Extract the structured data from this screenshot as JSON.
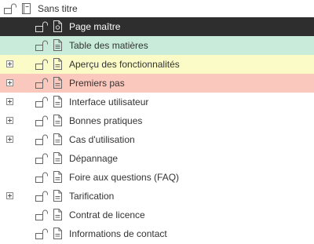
{
  "colors": {
    "selected_bg": "#2e2e2e",
    "green_bg": "#c8ecd9",
    "yellow_bg": "#fbfbc8",
    "red_bg": "#fbc8bd"
  },
  "root": {
    "label": "Sans titre",
    "icon": "notebook-icon"
  },
  "items": [
    {
      "label": "Page maître",
      "icon": "master-page-icon",
      "expandable": false,
      "state": "selected"
    },
    {
      "label": "Table des matières",
      "icon": "toc-page-icon",
      "expandable": false,
      "state": "green"
    },
    {
      "label": "Aperçu des fonctionnalités",
      "icon": "page-icon",
      "expandable": true,
      "state": "yellow"
    },
    {
      "label": "Premiers pas",
      "icon": "page-icon",
      "expandable": true,
      "state": "red"
    },
    {
      "label": "Interface utilisateur",
      "icon": "page-icon",
      "expandable": true,
      "state": "normal"
    },
    {
      "label": "Bonnes pratiques",
      "icon": "page-icon",
      "expandable": true,
      "state": "normal"
    },
    {
      "label": "Cas d'utilisation",
      "icon": "page-icon",
      "expandable": true,
      "state": "normal"
    },
    {
      "label": "Dépannage",
      "icon": "page-icon",
      "expandable": false,
      "state": "normal"
    },
    {
      "label": "Foire aux questions (FAQ)",
      "icon": "page-icon",
      "expandable": false,
      "state": "normal"
    },
    {
      "label": "Tarification",
      "icon": "page-icon",
      "expandable": true,
      "state": "normal"
    },
    {
      "label": "Contrat de licence",
      "icon": "page-icon",
      "expandable": false,
      "state": "normal"
    },
    {
      "label": "Informations de contact",
      "icon": "page-icon",
      "expandable": false,
      "state": "normal"
    }
  ]
}
